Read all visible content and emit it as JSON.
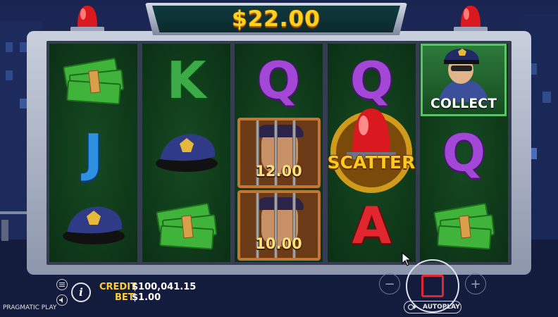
{
  "win": {
    "amount": "$22.00"
  },
  "reels": [
    [
      {
        "type": "cash"
      },
      {
        "type": "letter",
        "text": "J"
      },
      {
        "type": "hat"
      }
    ],
    [
      {
        "type": "letter",
        "text": "K"
      },
      {
        "type": "hat"
      },
      {
        "type": "cash"
      }
    ],
    [
      {
        "type": "letter",
        "text": "Q"
      },
      {
        "type": "jail",
        "value": "12.00"
      },
      {
        "type": "jail",
        "value": "10.00"
      }
    ],
    [
      {
        "type": "letter",
        "text": "Q"
      },
      {
        "type": "scatter",
        "text": "SCATTER"
      },
      {
        "type": "letter",
        "text": "A"
      }
    ],
    [
      {
        "type": "collect",
        "text": "COLLECT"
      },
      {
        "type": "letter",
        "text": "Q"
      },
      {
        "type": "cash"
      }
    ]
  ],
  "hud": {
    "credit_label": "CREDIT",
    "credit_value": "$100,041.15",
    "bet_label": "BET",
    "bet_value": "$1.00",
    "autoplay_label": "AUTOPLAY",
    "info_label": "i"
  },
  "brand": "PRAGMATIC PLAY",
  "colors": {
    "accent": "#ffcc33",
    "spin_red": "#e0262e",
    "reel_green": "#164a21"
  }
}
